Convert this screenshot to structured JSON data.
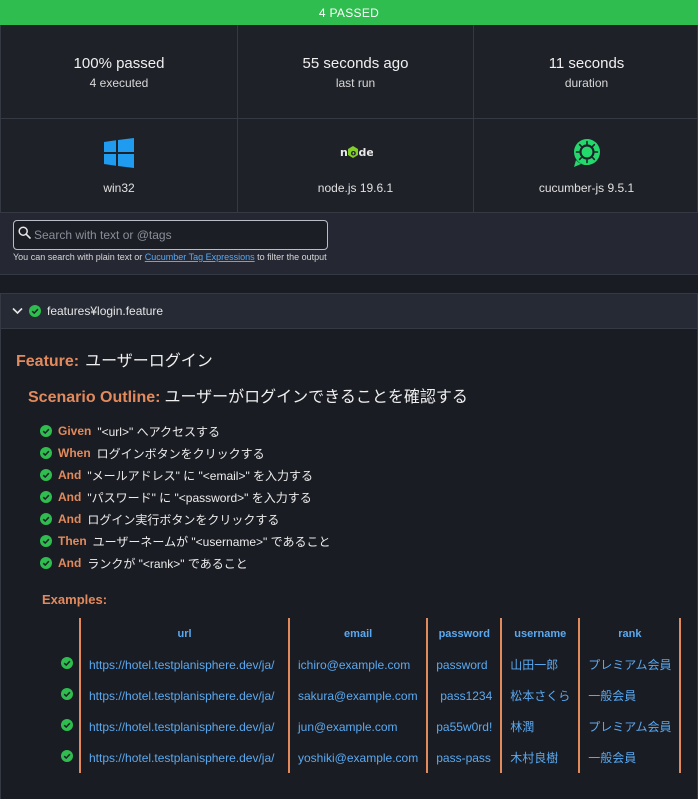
{
  "banner": {
    "text": "4 PASSED"
  },
  "stats": {
    "passed": {
      "value": "100% passed",
      "sub": "4 executed"
    },
    "last_run": {
      "value": "55 seconds ago",
      "sub": "last run"
    },
    "duration": {
      "value": "11 seconds",
      "sub": "duration"
    }
  },
  "env": {
    "os": {
      "label": "win32",
      "icon": "windows-logo-icon"
    },
    "runtime": {
      "label": "node.js 19.6.1",
      "icon": "nodejs-logo-icon"
    },
    "tool": {
      "label": "cucumber-js 9.5.1",
      "icon": "cucumber-logo-icon"
    }
  },
  "search": {
    "placeholder": "Search with text or @tags",
    "hint_prefix": "You can search with plain text or ",
    "hint_link": "Cucumber Tag Expressions",
    "hint_suffix": " to filter the output"
  },
  "feature": {
    "path": "features¥login.feature",
    "keyword": "Feature:",
    "name": "ユーザーログイン",
    "scenario_keyword": "Scenario Outline:",
    "scenario_name": "ユーザーがログインできることを確認する",
    "steps": [
      {
        "keyword": "Given",
        "text": "\"<url>\" へアクセスする"
      },
      {
        "keyword": "When",
        "text": "ログインボタンをクリックする"
      },
      {
        "keyword": "And",
        "text": "\"メールアドレス\" に \"<email>\" を入力する"
      },
      {
        "keyword": "And",
        "text": "\"パスワード\" に \"<password>\" を入力する"
      },
      {
        "keyword": "And",
        "text": "ログイン実行ボタンをクリックする"
      },
      {
        "keyword": "Then",
        "text": "ユーザーネームが \"<username>\" であること"
      },
      {
        "keyword": "And",
        "text": "ランクが \"<rank>\" であること"
      }
    ],
    "examples_label": "Examples:",
    "examples": {
      "headers": [
        "url",
        "email",
        "password",
        "username",
        "rank"
      ],
      "rows": [
        [
          "https://hotel.testplanisphere.dev/ja/",
          "ichiro@example.com",
          "password",
          "山田一郎",
          "プレミアム会員"
        ],
        [
          "https://hotel.testplanisphere.dev/ja/",
          "sakura@example.com",
          "pass1234",
          "松本さくら",
          "一般会員"
        ],
        [
          "https://hotel.testplanisphere.dev/ja/",
          "jun@example.com",
          "pa55w0rd!",
          "林潤",
          "プレミアム会員"
        ],
        [
          "https://hotel.testplanisphere.dev/ja/",
          "yoshiki@example.com",
          "pass-pass",
          "木村良樹",
          "一般会員"
        ]
      ]
    }
  },
  "colors": {
    "pass": "#2ebd4e",
    "keyword": "#e38a5c",
    "link": "#5aa9f0",
    "background": "#1a1c23"
  }
}
